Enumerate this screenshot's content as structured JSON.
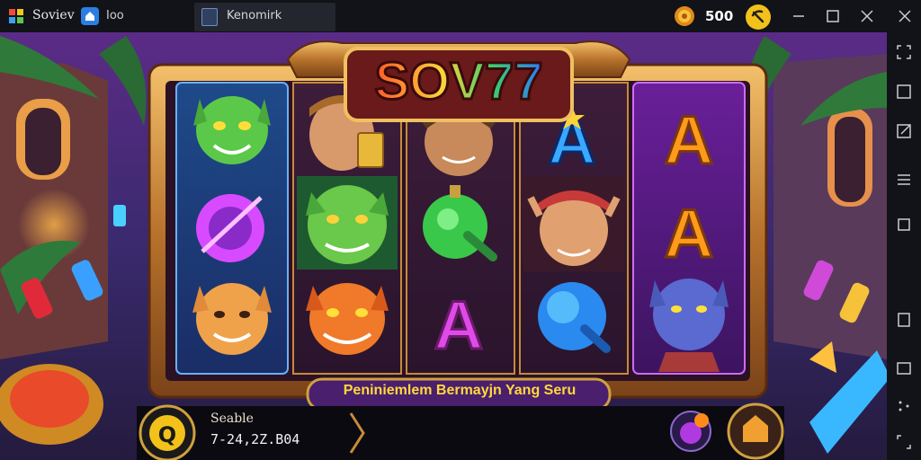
{
  "titlebar": {
    "app_name": "Soviev",
    "home_tab": "Ioo",
    "active_tab": "Kenomirk",
    "coin_count": "500"
  },
  "game": {
    "logo": "SOV77",
    "banner": "Peniniemlem Bermayjn Yang Seru",
    "balance_label": "Seable",
    "balance_value": "7-24,2Z.B04"
  },
  "symbols": [
    [
      "green-goblin",
      "purple-gem",
      "golden-cat"
    ],
    [
      "thief-with-card",
      "green-ogre",
      "orange-fox"
    ],
    [
      "rogue-head",
      "green-potion",
      "letter-a-pink"
    ],
    [
      "letter-a-blue",
      "elf-archer",
      "blue-orb"
    ],
    [
      "letter-a-gold",
      "letter-a-gold",
      "blue-wolf-warrior"
    ]
  ],
  "colors": {
    "frame_gold": "#c8893a",
    "banner_purple": "#4a1f6e",
    "logo_red": "#e03a2a",
    "coin_gold": "#f2c21a"
  }
}
